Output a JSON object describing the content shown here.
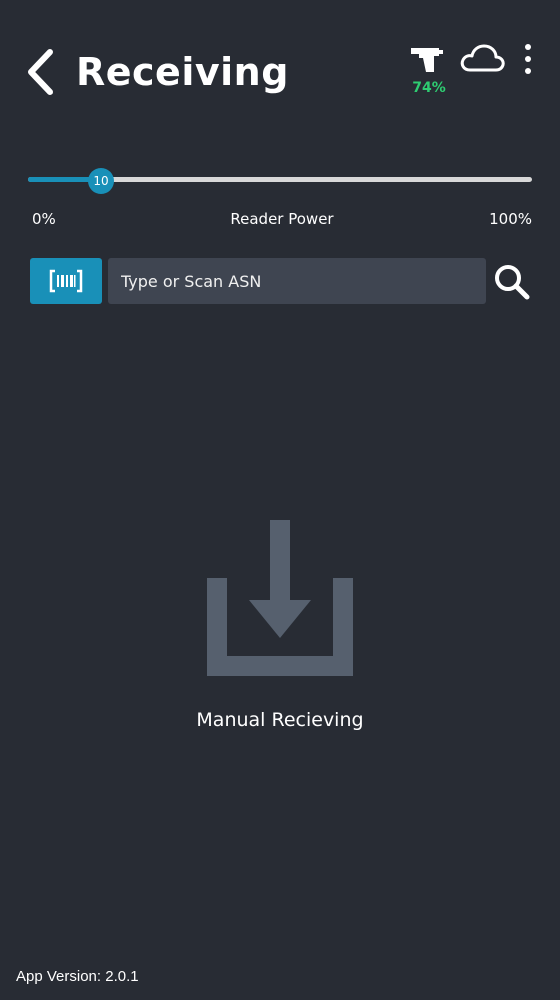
{
  "header": {
    "title": "Receiving",
    "back_icon": "chevron-left-icon",
    "reader_icon": "rfid-reader-icon",
    "battery": "74%",
    "battery_color": "#2ecc71",
    "cloud_icon": "cloud-icon",
    "menu_icon": "more-vertical-icon"
  },
  "reader_power": {
    "label": "Reader Power",
    "min_label": "0%",
    "max_label": "100%",
    "value": "10",
    "accent": "#1990b8"
  },
  "search": {
    "scan_icon": "barcode-icon",
    "placeholder": "Type or Scan ASN",
    "value": "",
    "search_icon": "search-icon"
  },
  "manual": {
    "icon": "download-tray-icon",
    "label": "Manual Recieving"
  },
  "footer": {
    "app_version": "App Version: 2.0.1"
  },
  "theme": {
    "background": "#282c34",
    "input_background": "#3f4551",
    "icon_muted": "#56606e"
  }
}
